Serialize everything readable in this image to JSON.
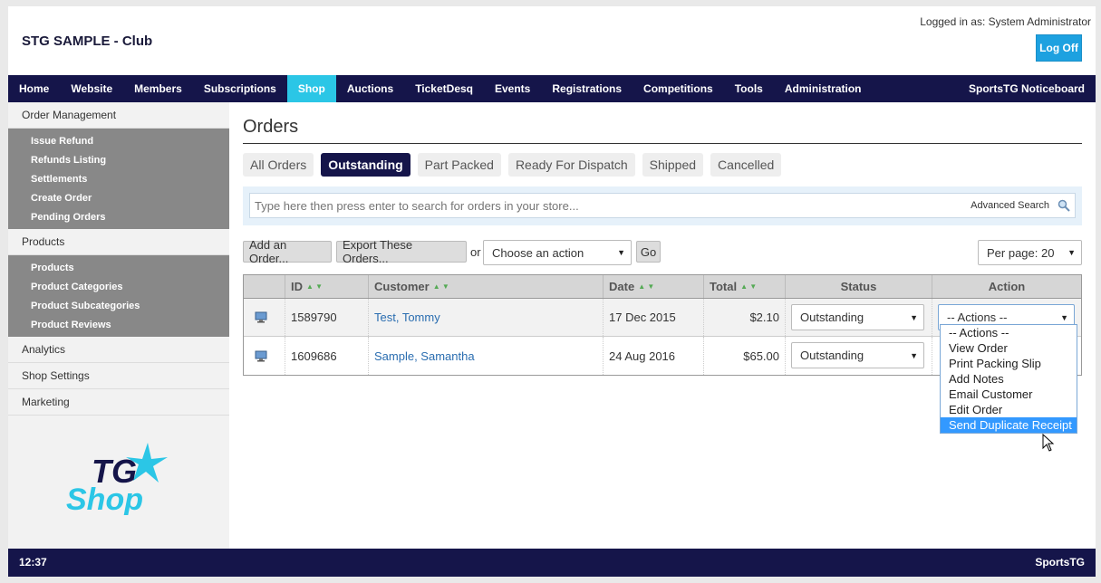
{
  "header": {
    "club_name": "STG SAMPLE - Club",
    "logged_in": "Logged in as: System Administrator",
    "logoff_label": "Log Off"
  },
  "nav": {
    "items": [
      "Home",
      "Website",
      "Members",
      "Subscriptions",
      "Shop",
      "Auctions",
      "TicketDesq",
      "Events",
      "Registrations",
      "Competitions",
      "Tools",
      "Administration"
    ],
    "active": "Shop",
    "right": "SportsTG Noticeboard"
  },
  "sidebar": {
    "order_management": "Order Management",
    "order_items": [
      "Issue Refund",
      "Refunds Listing",
      "Settlements",
      "Create Order",
      "Pending Orders"
    ],
    "products": "Products",
    "product_items": [
      "Products",
      "Product Categories",
      "Product Subcategories",
      "Product Reviews"
    ],
    "analytics": "Analytics",
    "shop_settings": "Shop Settings",
    "marketing": "Marketing",
    "logo_text_1": "TG",
    "logo_text_2": "Shop"
  },
  "main": {
    "title": "Orders",
    "tabs": [
      "All Orders",
      "Outstanding",
      "Part Packed",
      "Ready For Dispatch",
      "Shipped",
      "Cancelled"
    ],
    "active_tab": "Outstanding",
    "search_placeholder": "Type here then press enter to search for orders in your store...",
    "advanced_search": "Advanced Search",
    "add_order": "Add an Order...",
    "export_orders": "Export These Orders...",
    "or": "or",
    "choose_action": "Choose an action",
    "go": "Go",
    "per_page": "Per page: 20"
  },
  "table": {
    "headers": [
      "ID",
      "Customer",
      "Date",
      "Total",
      "Status",
      "Action"
    ],
    "rows": [
      {
        "id": "1589790",
        "customer": "Test, Tommy",
        "date": "17 Dec 2015",
        "total": "$2.10",
        "status": "Outstanding",
        "action": "-- Actions --"
      },
      {
        "id": "1609686",
        "customer": "Sample, Samantha",
        "date": "24 Aug 2016",
        "total": "$65.00",
        "status": "Outstanding"
      }
    ]
  },
  "action_menu": {
    "options": [
      "-- Actions --",
      "View Order",
      "Print Packing Slip",
      "Add Notes",
      "Email Customer",
      "Edit Order",
      "Send Duplicate Receipt"
    ],
    "highlighted": "Send Duplicate Receipt"
  },
  "footer": {
    "time": "12:37",
    "brand": "SportsTG"
  },
  "colors": {
    "nav_bg": "#15154a",
    "nav_active": "#2bc6e6",
    "logoff": "#1da1e0",
    "link": "#2a6db0",
    "highlight": "#3399ff"
  }
}
